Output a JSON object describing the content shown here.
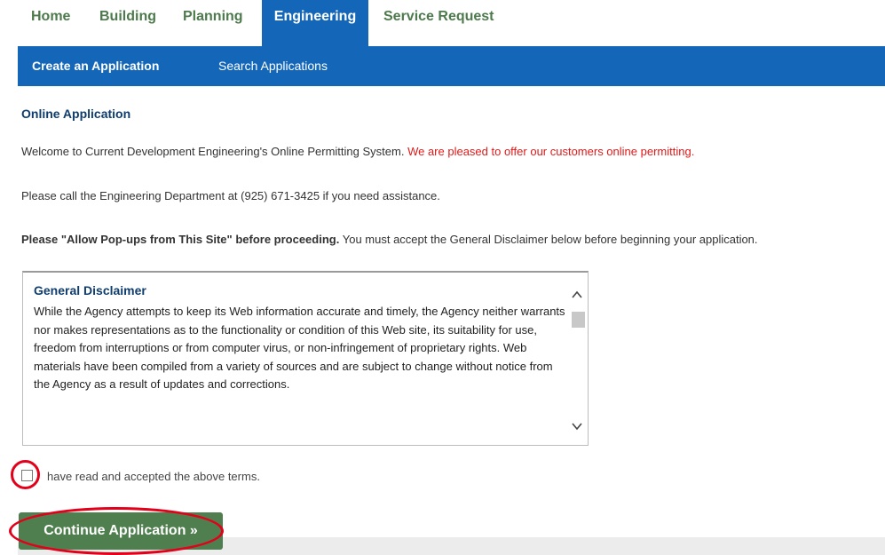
{
  "nav": {
    "tabs": [
      {
        "label": "Home"
      },
      {
        "label": "Building"
      },
      {
        "label": "Planning"
      },
      {
        "label": "Engineering",
        "active": true
      },
      {
        "label": "Service Request"
      }
    ]
  },
  "subnav": {
    "items": [
      {
        "label": "Create an Application"
      },
      {
        "label": "Search Applications"
      }
    ]
  },
  "main": {
    "heading": "Online Application",
    "welcome": "Welcome to Current Development Engineering's Online Permitting System.",
    "welcome_highlight": "We are pleased to offer our customers online permitting.",
    "assist": "Please call the Engineering Department at (925) 671-3425 if you need assistance.",
    "popups_bold": "Please \"Allow Pop-ups from This Site\" before proceeding.",
    "popups_rest": "You must accept the General Disclaimer below before beginning your application.",
    "disclaimer": {
      "title": "General Disclaimer",
      "body": "While the Agency attempts to keep its Web information accurate and timely, the Agency neither warrants nor makes representations as to the functionality or condition of this Web site, its suitability for use, freedom from interruptions or from computer virus, or non-infringement of proprietary rights. Web materials have been compiled from a variety of sources and are subject to change without notice from the Agency as a result of updates and corrections."
    },
    "accept_label": "have read and accepted the above terms.",
    "continue_label": "Continue Application »"
  },
  "colors": {
    "nav_green": "#4d7a4c",
    "nav_blue": "#1467b8",
    "highlight_red": "#e01a1a",
    "button_green": "#4f7f4e",
    "annotation_red": "#e2001a"
  }
}
